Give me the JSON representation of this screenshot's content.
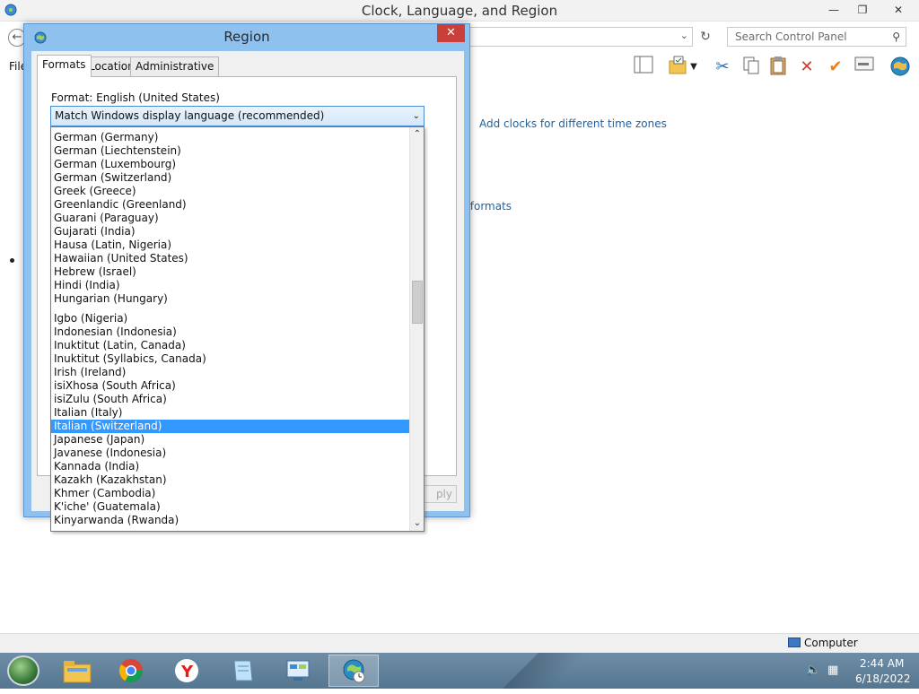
{
  "window": {
    "title": "Clock, Language, and Region",
    "minimize": "—",
    "restore": "❐",
    "close": "✕"
  },
  "address": {
    "search_placeholder": "Search Control Panel"
  },
  "menu": {
    "file": "File"
  },
  "main_links": {
    "add_clocks": "Add clocks for different time zones",
    "formats_partial": "r formats"
  },
  "dialog": {
    "title": "Region",
    "close": "✕",
    "tabs": [
      "Formats",
      "Location",
      "Administrative"
    ],
    "format_label": "Format: English (United States)",
    "combo_value": "Match Windows display language (recommended)",
    "apply_partial": "ply"
  },
  "dropdown": {
    "items_top": [
      "German (Germany)",
      "German (Liechtenstein)",
      "German (Luxembourg)",
      "German (Switzerland)",
      "Greek (Greece)",
      "Greenlandic (Greenland)",
      "Guarani (Paraguay)",
      "Gujarati (India)",
      "Hausa (Latin, Nigeria)",
      "Hawaiian (United States)",
      "Hebrew (Israel)",
      "Hindi (India)",
      "Hungarian (Hungary)"
    ],
    "items_bottom": [
      "Igbo (Nigeria)",
      "Indonesian (Indonesia)",
      "Inuktitut (Latin, Canada)",
      "Inuktitut (Syllabics, Canada)",
      "Irish (Ireland)",
      "isiXhosa (South Africa)",
      "isiZulu (South Africa)",
      "Italian (Italy)",
      "Italian (Switzerland)",
      "Japanese (Japan)",
      "Javanese (Indonesia)",
      "Kannada (India)",
      "Kazakh (Kazakhstan)",
      "Khmer (Cambodia)",
      "K'iche' (Guatemala)",
      "Kinyarwanda (Rwanda)"
    ],
    "selected": "Italian (Switzerland)",
    "scroll_position": 0.42
  },
  "statusbar": {
    "computer": "Computer"
  },
  "taskbar": {
    "time": "2:44 AM",
    "date": "6/18/2022"
  },
  "colors": {
    "selection": "#3399ff",
    "link": "#1a64a8",
    "dialog_frame": "#8fc1ef",
    "close_red": "#c9403a"
  }
}
